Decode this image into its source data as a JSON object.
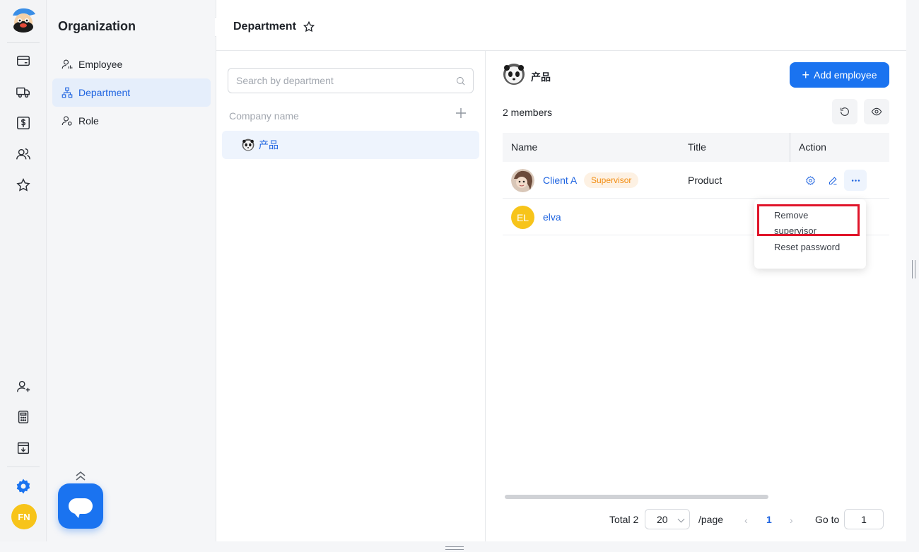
{
  "sidebar": {
    "title": "Organization",
    "items": [
      {
        "label": "Employee"
      },
      {
        "label": "Department"
      },
      {
        "label": "Role"
      }
    ]
  },
  "user": {
    "initials": "FN"
  },
  "header": {
    "title": "Department"
  },
  "department_panel": {
    "search_placeholder": "Search by department",
    "company_label": "Company name",
    "selected_department": "产品"
  },
  "members_panel": {
    "department_name": "产品",
    "add_button_label": "Add employee",
    "member_count": "2 members",
    "columns": {
      "name": "Name",
      "title": "Title",
      "action": "Action"
    },
    "rows": [
      {
        "name": "Client A",
        "badge": "Supervisor",
        "title": "Product"
      },
      {
        "name": "elva",
        "initials": "EL",
        "title": ""
      }
    ]
  },
  "action_menu": {
    "remove_supervisor": "Remove  supervisor",
    "reset_password": "Reset password"
  },
  "pagination": {
    "total": "Total 2",
    "page_size": "20",
    "per_page": "/page",
    "current_page": "1",
    "goto_label": "Go to",
    "goto_value": "1"
  },
  "colors": {
    "accent": "#1a73f0",
    "highlight_box": "#e0152a",
    "badge_text": "#f28c0f"
  }
}
